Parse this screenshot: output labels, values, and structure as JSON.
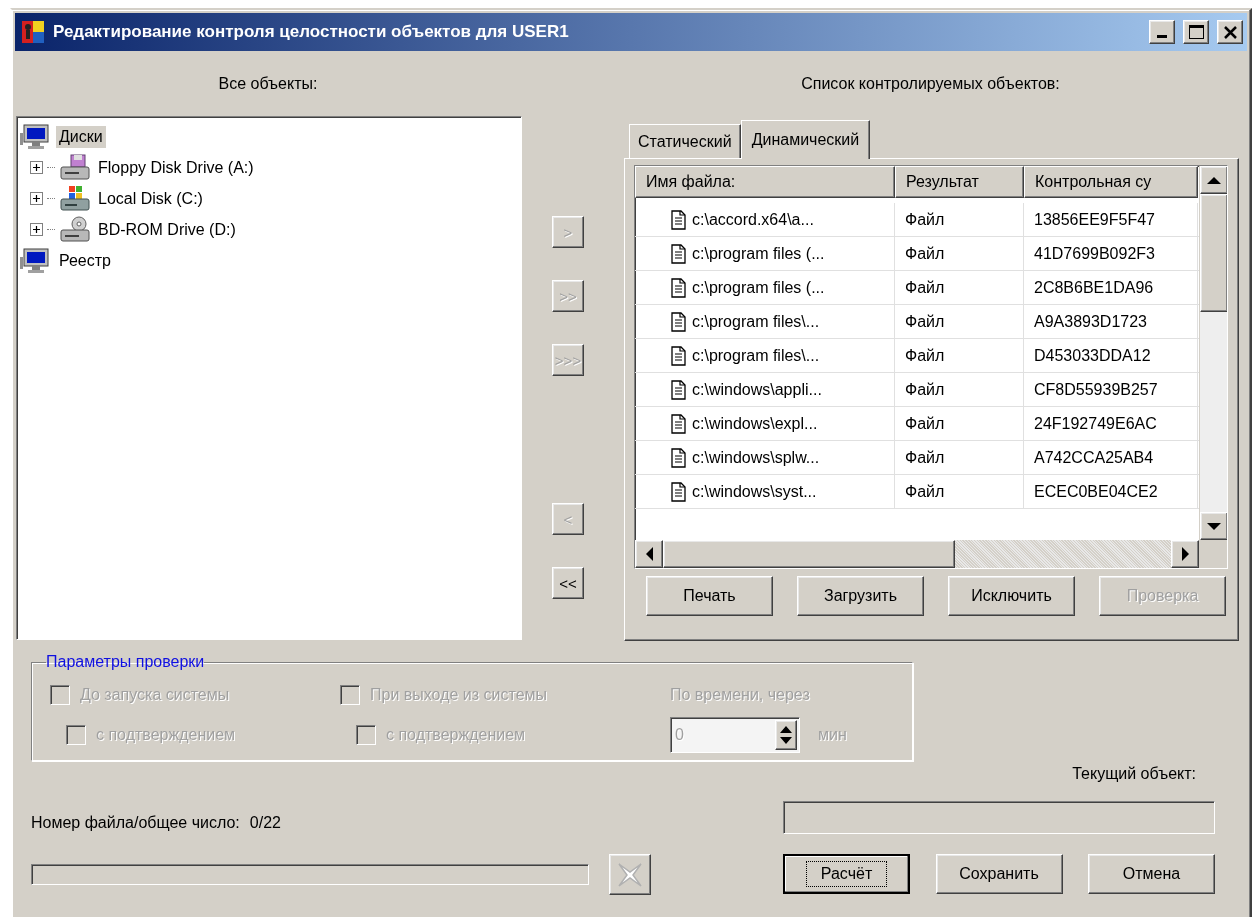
{
  "window": {
    "title": "Редактирование контроля целостности объектов для USER1"
  },
  "all_objects": {
    "label": "Все объекты:",
    "tree": [
      {
        "label": "Диски",
        "kind": "computer",
        "selected": true,
        "children": [
          {
            "label": "Floppy Disk Drive (A:)",
            "kind": "floppy",
            "expanded": false,
            "selected": false
          },
          {
            "label": "Local Disk (C:)",
            "kind": "harddisk",
            "expanded": false,
            "selected": false
          },
          {
            "label": "BD-ROM Drive (D:)",
            "kind": "optical",
            "expanded": false,
            "selected": false
          }
        ]
      },
      {
        "label": "Реестр",
        "kind": "computer",
        "selected": false
      }
    ]
  },
  "transfer_buttons": [
    {
      "label": ">",
      "kind": "add",
      "disabled": true
    },
    {
      "label": ">>",
      "kind": "add",
      "disabled": true
    },
    {
      "label": ">>>",
      "kind": "add",
      "disabled": true
    },
    {
      "label": "<",
      "kind": "remove",
      "disabled": true
    },
    {
      "label": "<<",
      "kind": "remove",
      "disabled": false
    }
  ],
  "monitored": {
    "label": "Список контролируемых объектов:",
    "tabs": [
      {
        "label": "Статический",
        "selected": false
      },
      {
        "label": "Динамический",
        "selected": true
      }
    ],
    "table": {
      "columns": [
        "Имя файла:",
        "Результат",
        "Контрольная су"
      ],
      "rows": [
        {
          "name": "c:\\accord.x64\\a...",
          "result": "Файл",
          "checksum": "13856EE9F5F47"
        },
        {
          "name": "c:\\program files (...",
          "result": "Файл",
          "checksum": "41D7699B092F3"
        },
        {
          "name": "c:\\program files (...",
          "result": "Файл",
          "checksum": "2C8B6BE1DA96"
        },
        {
          "name": "c:\\program files\\...",
          "result": "Файл",
          "checksum": "A9A3893D1723"
        },
        {
          "name": "c:\\program files\\...",
          "result": "Файл",
          "checksum": "D453033DDA12"
        },
        {
          "name": "c:\\windows\\appli...",
          "result": "Файл",
          "checksum": "CF8D55939B257"
        },
        {
          "name": "c:\\windows\\expl...",
          "result": "Файл",
          "checksum": "24F192749E6AC"
        },
        {
          "name": "c:\\windows\\splw...",
          "result": "Файл",
          "checksum": "A742CCA25AB4"
        },
        {
          "name": "c:\\windows\\syst...",
          "result": "Файл",
          "checksum": "ECEC0BE04CE2"
        }
      ]
    },
    "buttons": [
      {
        "label": "Печать",
        "disabled": false
      },
      {
        "label": "Загрузить",
        "disabled": false
      },
      {
        "label": "Исключить",
        "disabled": false
      },
      {
        "label": "Проверка",
        "disabled": true
      }
    ]
  },
  "params": {
    "title": "Параметры проверки",
    "checkboxes": [
      {
        "label": "До запуска системы",
        "kind": "main",
        "checked": false,
        "disabled": true
      },
      {
        "label": "При выходе из системы",
        "kind": "main",
        "checked": false,
        "disabled": true
      },
      {
        "label": "с подтверждением",
        "kind": "sub",
        "checked": false,
        "disabled": true
      },
      {
        "label": "с подтверждением",
        "kind": "sub",
        "checked": false,
        "disabled": true
      }
    ],
    "timer": {
      "label": "По времени, через",
      "value": "0",
      "unit": "мин",
      "disabled": true
    }
  },
  "current_object": {
    "label": "Текущий объект:"
  },
  "progress": {
    "label": "Номер файла/общее число:",
    "count": "0/22",
    "level": 0,
    "stop_disabled": true
  },
  "actions": [
    {
      "label": "Расчёт",
      "default": true
    },
    {
      "label": "Сохранить",
      "default": false
    },
    {
      "label": "Отмена",
      "default": false
    }
  ]
}
